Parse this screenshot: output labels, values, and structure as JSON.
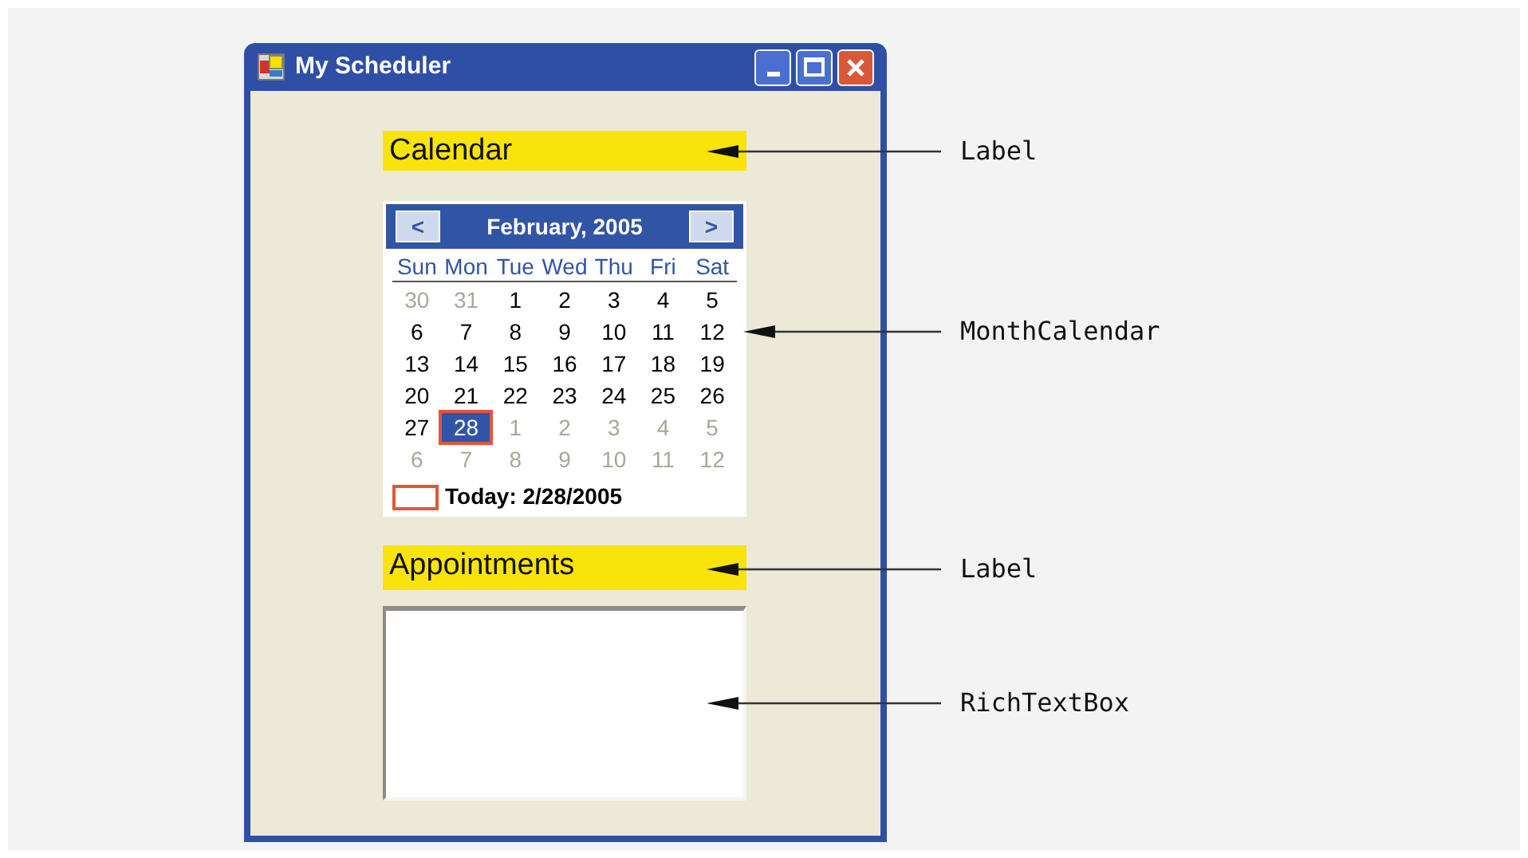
{
  "window": {
    "title": "My Scheduler"
  },
  "calendar_label": "Calendar",
  "calendar": {
    "month": "February, 2005",
    "prev": "<",
    "next": ">",
    "weekdays": [
      "Sun",
      "Mon",
      "Tue",
      "Wed",
      "Thu",
      "Fri",
      "Sat"
    ],
    "weeks": [
      [
        {
          "d": "30",
          "dimmed": true,
          "selected": false
        },
        {
          "d": "31",
          "dimmed": true,
          "selected": false
        },
        {
          "d": "1",
          "dimmed": false,
          "selected": false
        },
        {
          "d": "2",
          "dimmed": false,
          "selected": false
        },
        {
          "d": "3",
          "dimmed": false,
          "selected": false
        },
        {
          "d": "4",
          "dimmed": false,
          "selected": false
        },
        {
          "d": "5",
          "dimmed": false,
          "selected": false
        }
      ],
      [
        {
          "d": "6",
          "dimmed": false,
          "selected": false
        },
        {
          "d": "7",
          "dimmed": false,
          "selected": false
        },
        {
          "d": "8",
          "dimmed": false,
          "selected": false
        },
        {
          "d": "9",
          "dimmed": false,
          "selected": false
        },
        {
          "d": "10",
          "dimmed": false,
          "selected": false
        },
        {
          "d": "11",
          "dimmed": false,
          "selected": false
        },
        {
          "d": "12",
          "dimmed": false,
          "selected": false
        }
      ],
      [
        {
          "d": "13",
          "dimmed": false,
          "selected": false
        },
        {
          "d": "14",
          "dimmed": false,
          "selected": false
        },
        {
          "d": "15",
          "dimmed": false,
          "selected": false
        },
        {
          "d": "16",
          "dimmed": false,
          "selected": false
        },
        {
          "d": "17",
          "dimmed": false,
          "selected": false
        },
        {
          "d": "18",
          "dimmed": false,
          "selected": false
        },
        {
          "d": "19",
          "dimmed": false,
          "selected": false
        }
      ],
      [
        {
          "d": "20",
          "dimmed": false,
          "selected": false
        },
        {
          "d": "21",
          "dimmed": false,
          "selected": false
        },
        {
          "d": "22",
          "dimmed": false,
          "selected": false
        },
        {
          "d": "23",
          "dimmed": false,
          "selected": false
        },
        {
          "d": "24",
          "dimmed": false,
          "selected": false
        },
        {
          "d": "25",
          "dimmed": false,
          "selected": false
        },
        {
          "d": "26",
          "dimmed": false,
          "selected": false
        }
      ],
      [
        {
          "d": "27",
          "dimmed": false,
          "selected": false
        },
        {
          "d": "28",
          "dimmed": false,
          "selected": true
        },
        {
          "d": "1",
          "dimmed": true,
          "selected": false
        },
        {
          "d": "2",
          "dimmed": true,
          "selected": false
        },
        {
          "d": "3",
          "dimmed": true,
          "selected": false
        },
        {
          "d": "4",
          "dimmed": true,
          "selected": false
        },
        {
          "d": "5",
          "dimmed": true,
          "selected": false
        }
      ],
      [
        {
          "d": "6",
          "dimmed": true,
          "selected": false
        },
        {
          "d": "7",
          "dimmed": true,
          "selected": false
        },
        {
          "d": "8",
          "dimmed": true,
          "selected": false
        },
        {
          "d": "9",
          "dimmed": true,
          "selected": false
        },
        {
          "d": "10",
          "dimmed": true,
          "selected": false
        },
        {
          "d": "11",
          "dimmed": true,
          "selected": false
        },
        {
          "d": "12",
          "dimmed": true,
          "selected": false
        }
      ]
    ],
    "today": "Today: 2/28/2005"
  },
  "appointments_label": "Appointments",
  "callouts": [
    "Label",
    "MonthCalendar",
    "Label",
    "RichTextBox"
  ]
}
